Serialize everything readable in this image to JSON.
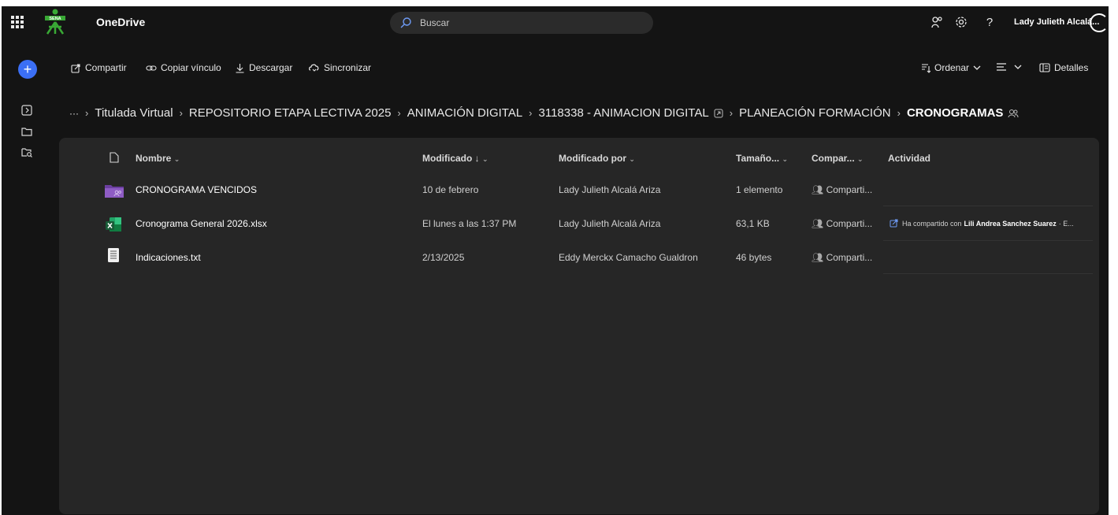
{
  "app": {
    "name": "OneDrive"
  },
  "search": {
    "placeholder": "Buscar"
  },
  "user": {
    "name": "Lady Julieth Alcalá..."
  },
  "toolbar": {
    "share": "Compartir",
    "copy_link": "Copiar vínculo",
    "download": "Descargar",
    "sync": "Sincronizar",
    "sort": "Ordenar",
    "details": "Detalles"
  },
  "breadcrumb": {
    "ellipsis": "···",
    "items": [
      "Titulada Virtual",
      "REPOSITORIO ETAPA LECTIVA 2025",
      "ANIMACIÓN DIGITAL",
      "3118338 - ANIMACION DIGITAL",
      "PLANEACIÓN FORMACIÓN"
    ],
    "current": "CRONOGRAMAS"
  },
  "columns": {
    "name": "Nombre",
    "modified": "Modificado",
    "modified_by": "Modificado por",
    "size": "Tamaño...",
    "shared": "Compar...",
    "activity": "Actividad"
  },
  "files": [
    {
      "name": "CRONOGRAMA VENCIDOS",
      "icon": "folder-icon",
      "modified": "10 de febrero",
      "modified_by": "Lady Julieth Alcalá Ariza",
      "size": "1 elemento",
      "shared": "Comparti..."
    },
    {
      "name": "Cronograma General 2026.xlsx",
      "icon": "excel-icon",
      "modified": "El lunes a las 1:37 PM",
      "modified_by": "Lady Julieth Alcalá Ariza",
      "size": "63,1 KB",
      "shared": "Comparti..."
    },
    {
      "name": "Indicaciones.txt",
      "icon": "text-file-icon",
      "modified": "2/13/2025",
      "modified_by": "Eddy Merckx Camacho Gualdron",
      "size": "46 bytes",
      "shared": "Comparti..."
    }
  ],
  "activity": {
    "prefix": "Ha compartido con",
    "person": "Lili Andrea Sanchez Suarez",
    "suffix": "· E..."
  },
  "colors": {
    "background": "#141414",
    "panel": "#262626",
    "accent": "#3b6ff5",
    "folder": "#8e5cc4",
    "excel": "#1e7b45"
  }
}
